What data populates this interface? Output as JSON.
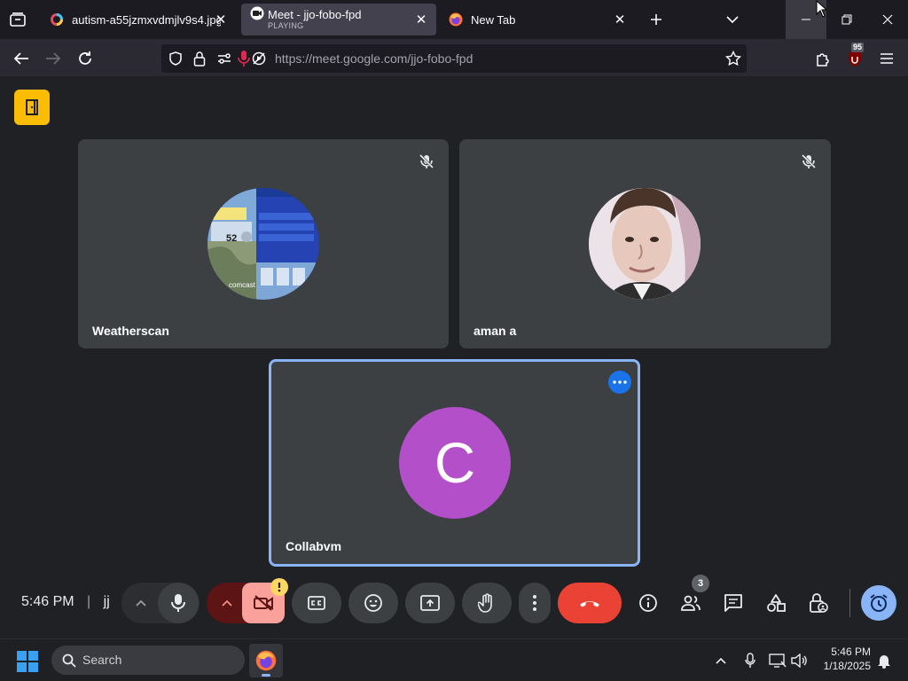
{
  "tabs": [
    {
      "title": "autism-a55jzmxvdmjlv9s4.jpg (J"
    },
    {
      "title": "Meet - jjo-fobo-fpd",
      "subtitle": "PLAYING"
    },
    {
      "title": "New Tab"
    }
  ],
  "url": {
    "host": "https://meet.google.com",
    "path": "/jjo-fobo-fpd"
  },
  "extension_badge": "95",
  "participants": [
    {
      "name": "Weatherscan",
      "muted": true
    },
    {
      "name": "aman a",
      "muted": true
    },
    {
      "name": "Collabvm",
      "initial": "C",
      "avatar_color": "#b44fca",
      "active": true
    }
  ],
  "weather_thumb": {
    "temp": "52",
    "brand": "comcast"
  },
  "footer": {
    "time": "5:46 PM",
    "separator": "|",
    "meeting_code": "jj"
  },
  "people_count": "3",
  "taskbar": {
    "search_label": "Search",
    "clock_time": "5:46 PM",
    "clock_date": "1/18/2025"
  },
  "colors": {
    "accent_blue": "#8ab4f8",
    "end_call_red": "#ea4335",
    "leave_yellow": "#fbbc04"
  }
}
